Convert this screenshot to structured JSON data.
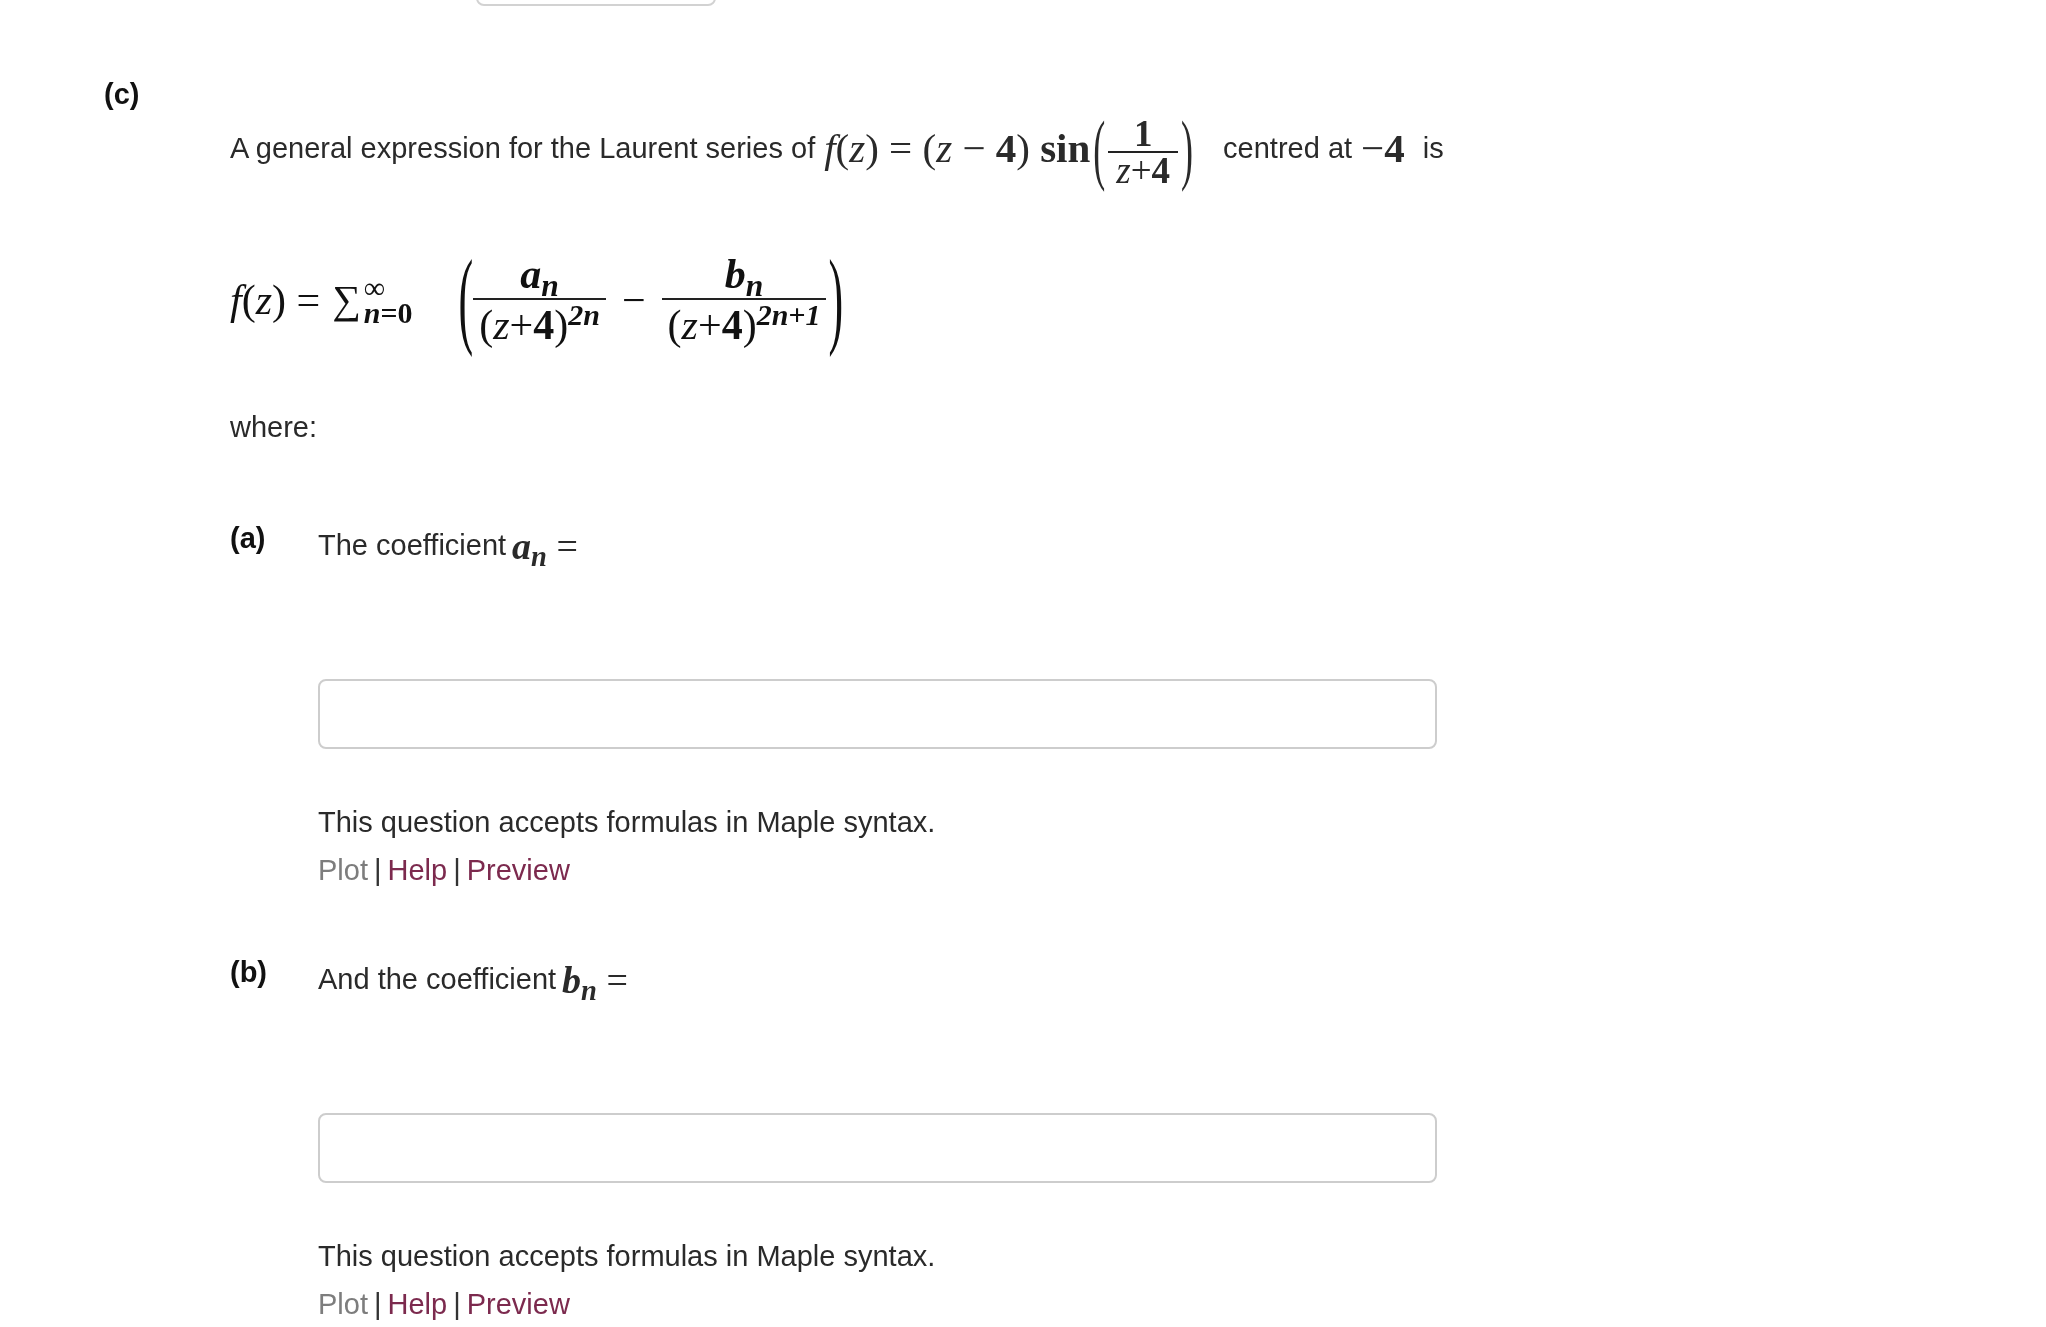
{
  "section": {
    "label": "(c)",
    "question": {
      "text_before": "A general expression for the Laurent series of",
      "function": {
        "lhs": "*f*(*z*) = (*z* − **4**) **sin**",
        "open": "(",
        "numerator": "1",
        "denominator": "*z*+**4**",
        "close": ")"
      },
      "text_middle": "centred at",
      "centre": "−**4**",
      "text_after": "is"
    },
    "series": {
      "lhs": "*f*(*z*) =",
      "sum": "∑",
      "sum_upper": "∞",
      "sum_lower": "*n*=0",
      "open": "(",
      "terms": [
        {
          "numerator": "*a*$_{n}$",
          "base": "(*z*+**4**)",
          "exponent": "2n"
        },
        {
          "sign": "−",
          "numerator": "*b*$_{n}$",
          "base": "(*z*+**4**)",
          "exponent": "2n+1"
        }
      ],
      "close": ")"
    },
    "where": "where:",
    "parts": [
      {
        "label": "(a)",
        "prompt": "The coefficient",
        "symbol": "*a*$_{n}$ =",
        "note": "This question accepts formulas in Maple syntax.",
        "links": [
          {
            "label": "Plot",
            "disabled": true
          },
          {
            "separator": "|",
            "label": "Help",
            "disabled": false
          },
          {
            "separator": "|",
            "label": "Preview",
            "disabled": false
          }
        ]
      },
      {
        "label": "(b)",
        "prompt": "And the coefficient",
        "symbol": "*b*$_{n}$ =",
        "note": "This question accepts formulas in Maple syntax.",
        "links": [
          {
            "label": "Plot",
            "disabled": true
          },
          {
            "separator": "|",
            "label": "Help",
            "disabled": false
          },
          {
            "separator": "|",
            "label": "Preview",
            "disabled": false
          }
        ]
      }
    ]
  }
}
